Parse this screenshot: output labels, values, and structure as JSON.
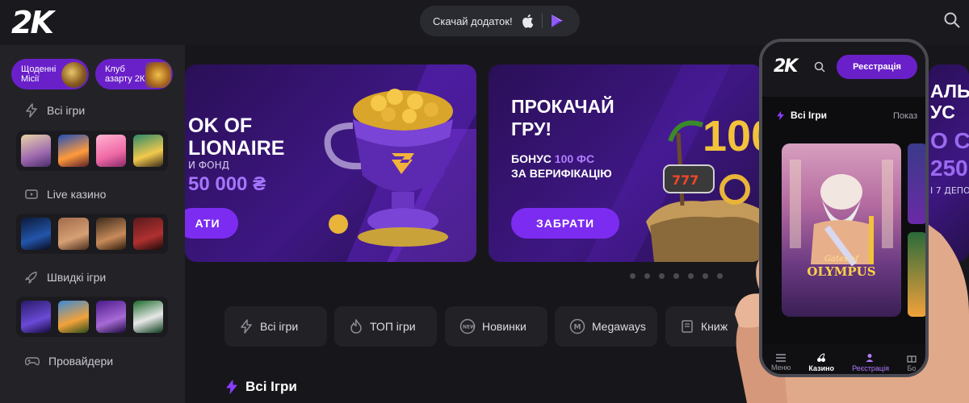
{
  "header": {
    "logo": "2K",
    "app_download": "Скачай додаток!",
    "apple_icon": "apple-icon",
    "play_icon": "google-play-icon",
    "search_icon": "search-icon"
  },
  "sidebar": {
    "promos": [
      {
        "label": "Щоденні Місії"
      },
      {
        "label": "Клуб азарту 2К"
      }
    ],
    "sections": [
      {
        "label": "Всі ігри",
        "icon": "lightning-icon"
      },
      {
        "label": "Live казино",
        "icon": "live-tv-icon"
      },
      {
        "label": "Швидкі ігри",
        "icon": "rocket-icon"
      },
      {
        "label": "Провайдери",
        "icon": "gamepad-icon"
      }
    ]
  },
  "banners": [
    {
      "title": "OK OF\nLIONAIRE",
      "subtitle": "И ФОНД",
      "amount": "50 000 ₴",
      "button": "АТИ"
    },
    {
      "title": "ПРОКАЧАЙ\nГРУ!",
      "bonus_prefix": "БОНУС ",
      "bonus_highlight": "100 ФС",
      "bonus_suffix": "ЗА ВЕРИФІКАЦІЮ",
      "button": "ЗАБРАТИ",
      "badge": "100"
    },
    {
      "title": "АЛЬН\nУС",
      "big": "О С\n250",
      "note": "І 7 ДЕПО"
    }
  ],
  "categories": [
    {
      "label": "Всі ігри",
      "icon": "lightning-icon"
    },
    {
      "label": "ТОП ігри",
      "icon": "fire-icon"
    },
    {
      "label": "Новинки",
      "icon": "new-badge-icon"
    },
    {
      "label": "Megaways",
      "icon": "megaways-icon"
    },
    {
      "label": "Книж",
      "icon": "book-icon"
    }
  ],
  "section_title": "Всі Ігри",
  "phone": {
    "logo": "2K",
    "register": "Реєстрація",
    "all_games": "Всі Ігри",
    "show": "Показ",
    "game_title_top": "Gates of",
    "game_title": "OLYMPUS",
    "nav": [
      {
        "label": "Меню",
        "icon": "menu-icon"
      },
      {
        "label": "Казино",
        "icon": "cherries-icon"
      },
      {
        "label": "Реєстрація",
        "icon": "user-plus-icon"
      },
      {
        "label": "Бо",
        "icon": "gift-icon"
      }
    ]
  },
  "colors": {
    "accent": "#7c2cf0",
    "background": "#17171b",
    "sidebar": "#232327"
  }
}
